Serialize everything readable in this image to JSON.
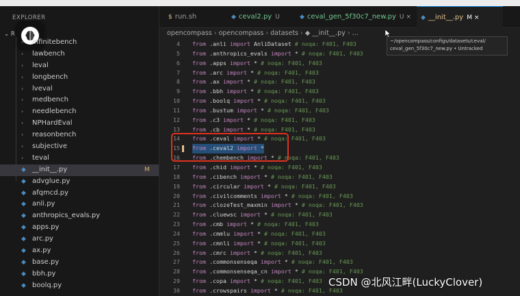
{
  "explorer": {
    "title": "EXPLORER",
    "root_label": "R",
    "items": [
      {
        "label": "infinitebench",
        "kind": "folder"
      },
      {
        "label": "lawbench",
        "kind": "folder"
      },
      {
        "label": "leval",
        "kind": "folder"
      },
      {
        "label": "longbench",
        "kind": "folder"
      },
      {
        "label": "lveval",
        "kind": "folder"
      },
      {
        "label": "medbench",
        "kind": "folder"
      },
      {
        "label": "needlebench",
        "kind": "folder"
      },
      {
        "label": "NPHardEval",
        "kind": "folder"
      },
      {
        "label": "reasonbench",
        "kind": "folder"
      },
      {
        "label": "subjective",
        "kind": "folder"
      },
      {
        "label": "teval",
        "kind": "folder"
      },
      {
        "label": "__init__.py",
        "kind": "py",
        "badge": "M",
        "active": true
      },
      {
        "label": "advglue.py",
        "kind": "py"
      },
      {
        "label": "afqmcd.py",
        "kind": "py"
      },
      {
        "label": "anli.py",
        "kind": "py"
      },
      {
        "label": "anthropics_evals.py",
        "kind": "py"
      },
      {
        "label": "apps.py",
        "kind": "py"
      },
      {
        "label": "arc.py",
        "kind": "py"
      },
      {
        "label": "ax.py",
        "kind": "py"
      },
      {
        "label": "base.py",
        "kind": "py"
      },
      {
        "label": "bbh.py",
        "kind": "py"
      },
      {
        "label": "boolq.py",
        "kind": "py"
      }
    ]
  },
  "tabs": [
    {
      "icon": "$",
      "label": "run.sh",
      "badge": ""
    },
    {
      "icon": "◆",
      "label": "ceval2.py",
      "badge": "U"
    },
    {
      "icon": "◆",
      "label": "ceval_gen_5f30c7_new.py",
      "badge": "U ×"
    },
    {
      "icon": "◆",
      "label": "__init__.py",
      "badge": "M ×",
      "active": true
    }
  ],
  "breadcrumb": [
    "opencompass",
    "opencompass",
    "datasets",
    "◆ __init__.py",
    "..."
  ],
  "tooltip": {
    "line1": "~/opencompass/configs/datasets/ceval/",
    "line2": "ceval_gen_5f30c7_new.py • Untracked"
  },
  "code_lines": [
    {
      "n": "4",
      "mod": ".anli",
      "imp": "AnliDataset",
      "cm": "# noqa: F401, F403"
    },
    {
      "n": "5",
      "mod": ".anthropics_evals",
      "imp": "*",
      "cm": "# noqa: F401, F403"
    },
    {
      "n": "6",
      "mod": ".apps",
      "imp": "*",
      "cm": "# noqa: F401, F403"
    },
    {
      "n": "7",
      "mod": ".arc",
      "imp": "*",
      "cm": "# noqa: F401, F403"
    },
    {
      "n": "8",
      "mod": ".ax",
      "imp": "*",
      "cm": "# noqa: F401, F403"
    },
    {
      "n": "9",
      "mod": ".bbh",
      "imp": "*",
      "cm": "# noqa: F401, F403"
    },
    {
      "n": "10",
      "mod": ".boolq",
      "imp": "*",
      "cm": "# noqa: F401, F403"
    },
    {
      "n": "11",
      "mod": ".bustum",
      "imp": "*",
      "cm": "# noqa: F401, F403"
    },
    {
      "n": "12",
      "mod": ".c3",
      "imp": "*",
      "cm": "# noqa: F401, F403"
    },
    {
      "n": "13",
      "mod": ".cb",
      "imp": "*",
      "cm": "# noqa: F401, F403"
    },
    {
      "n": "14",
      "mod": ".ceval",
      "imp": "*",
      "cm": "# noqa: F401, F403"
    },
    {
      "n": "15",
      "mod": ".ceval2",
      "imp": "*",
      "cm": "",
      "selected": true
    },
    {
      "n": "16",
      "mod": ".chembench",
      "imp": "*",
      "cm": "# noqa: F401, F403"
    },
    {
      "n": "17",
      "mod": ".chid",
      "imp": "*",
      "cm": "# noqa: F401, F403"
    },
    {
      "n": "18",
      "mod": ".cibench",
      "imp": "*",
      "cm": "# noqa: F401, F403"
    },
    {
      "n": "19",
      "mod": ".circular",
      "imp": "*",
      "cm": "# noqa: F401, F403"
    },
    {
      "n": "20",
      "mod": ".civilcomments",
      "imp": "*",
      "cm": "# noqa: F401, F403"
    },
    {
      "n": "21",
      "mod": ".clozeTest_maxmin",
      "imp": "*",
      "cm": "# noqa: F401, F403"
    },
    {
      "n": "22",
      "mod": ".cluewsc",
      "imp": "*",
      "cm": "# noqa: F401, F403"
    },
    {
      "n": "23",
      "mod": ".cmb",
      "imp": "*",
      "cm": "# noqa: F401, F403"
    },
    {
      "n": "24",
      "mod": ".cmmlu",
      "imp": "*",
      "cm": "# noqa: F401, F403"
    },
    {
      "n": "25",
      "mod": ".cmnli",
      "imp": "*",
      "cm": "# noqa: F401, F403"
    },
    {
      "n": "26",
      "mod": ".cmrc",
      "imp": "*",
      "cm": "# noqa: F401, F403"
    },
    {
      "n": "27",
      "mod": ".commonsenseqa",
      "imp": "*",
      "cm": "# noqa: F401, F403"
    },
    {
      "n": "28",
      "mod": ".commonsenseqa_cn",
      "imp": "*",
      "cm": "# noqa: F401, F403"
    },
    {
      "n": "29",
      "mod": ".copa",
      "imp": "*",
      "cm": "# noqa: F401, F403"
    },
    {
      "n": "30",
      "mod": ".crowspairs",
      "imp": "*",
      "cm": "# noqa: F401, F403"
    }
  ],
  "keywords": {
    "from": "from",
    "import": "import"
  },
  "watermark": "CSDN @北风江畔(LuckyClover)",
  "colors": {
    "accent": "#0078d4",
    "annotation": "#e0321e",
    "selection": "#264f78"
  }
}
